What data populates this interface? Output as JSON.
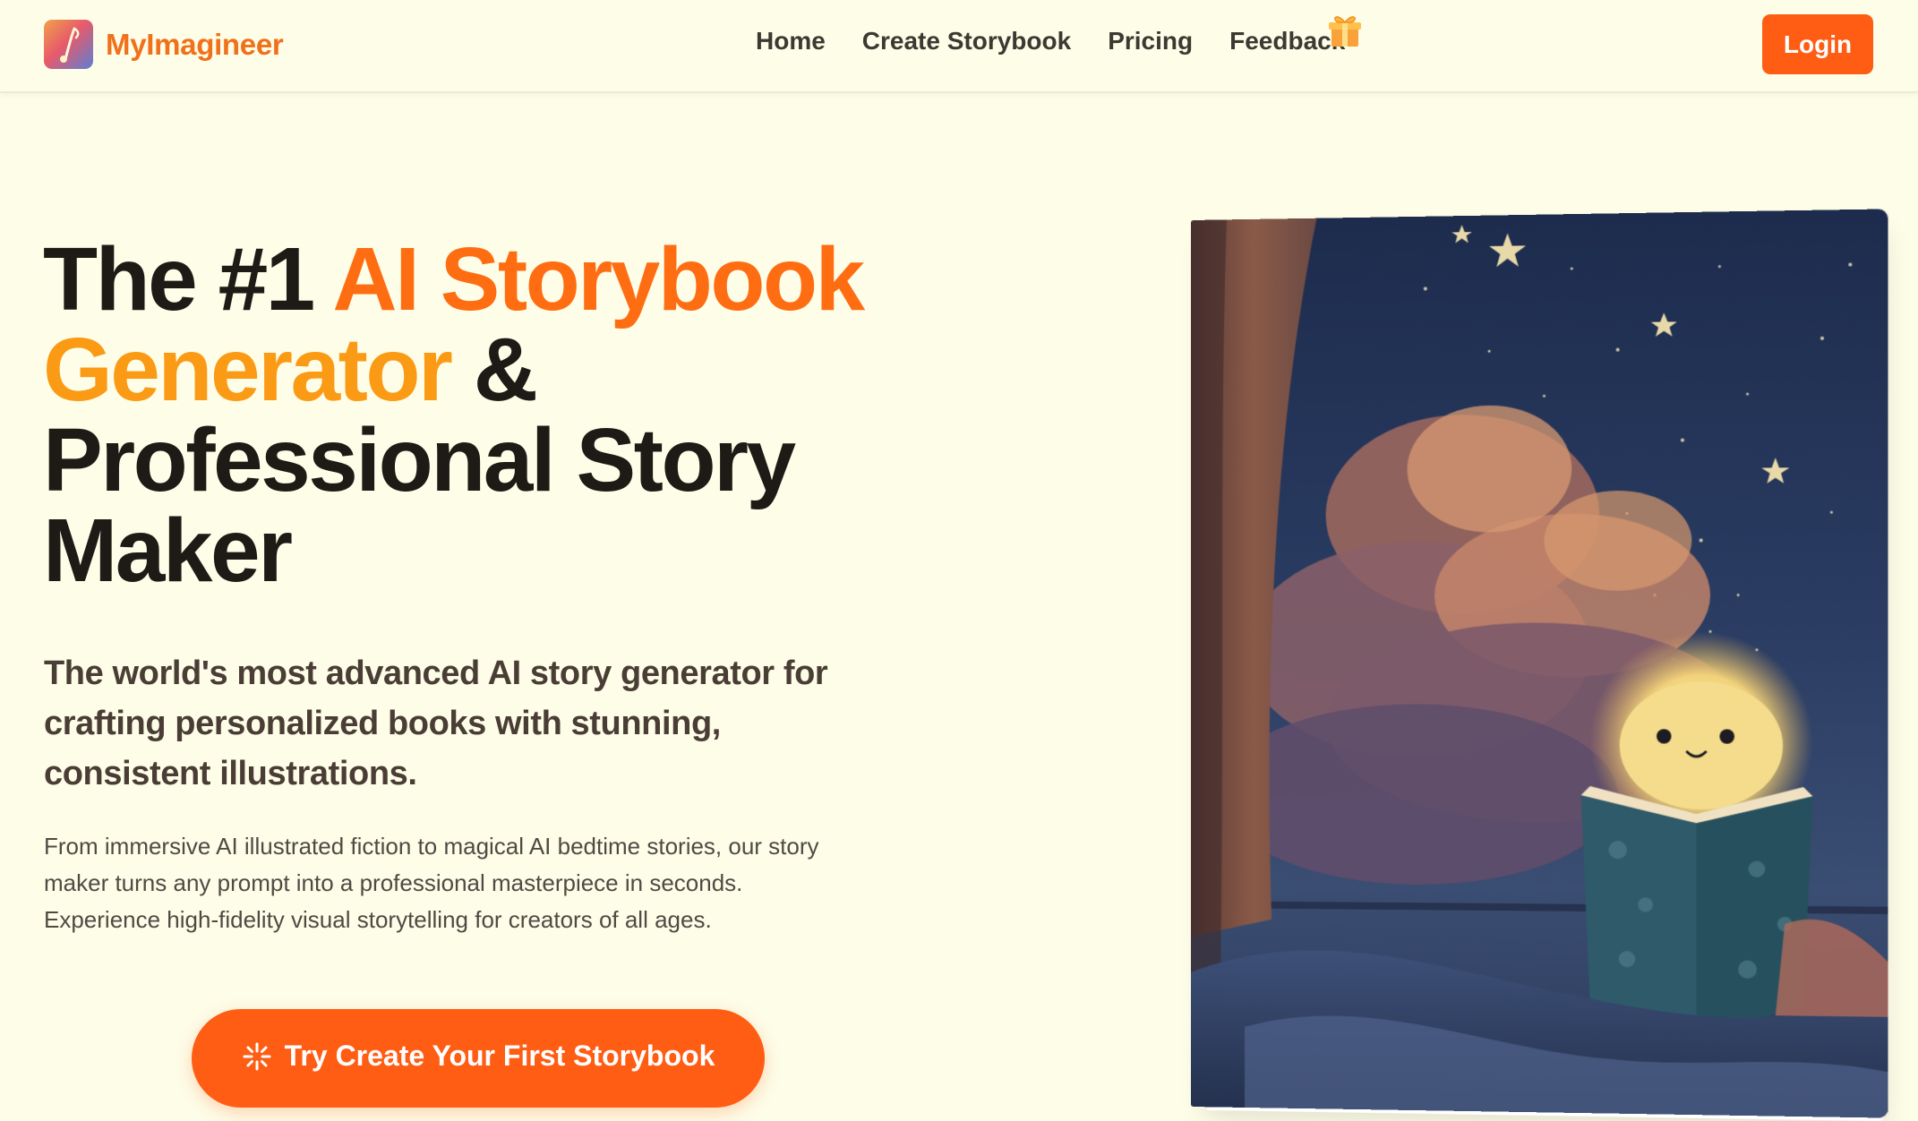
{
  "navbar": {
    "brand": "MyImagineer",
    "links": [
      {
        "label": "Home"
      },
      {
        "label": "Create Storybook"
      },
      {
        "label": "Pricing"
      },
      {
        "label": "Feedback"
      }
    ],
    "login_label": "Login"
  },
  "hero": {
    "title_part1": "The #1 ",
    "title_highlight1": "AI Storybook",
    "title_highlight2": "Generator",
    "title_part2": " &",
    "title_line3": "Professional Story",
    "title_line4": "Maker",
    "subtitle": "The world's most advanced AI story generator for crafting personalized books with stunning, consistent illustrations.",
    "description": "From immersive AI illustrated fiction to magical AI bedtime stories, our story maker turns any prompt into a professional masterpiece in seconds. Experience high-fidelity visual storytelling for creators of all ages.",
    "cta_label": "Try Create Your First Storybook"
  },
  "icons": {
    "gift": "gift-icon",
    "sparkle": "sparkle-icon",
    "logo": "brand-logo-icon"
  },
  "colors": {
    "accent": "#ff5d13",
    "brand_text": "#f0711a",
    "highlight_orange": "#ff6d12",
    "highlight_amber": "#fb9a14",
    "background": "#fdfde8"
  }
}
